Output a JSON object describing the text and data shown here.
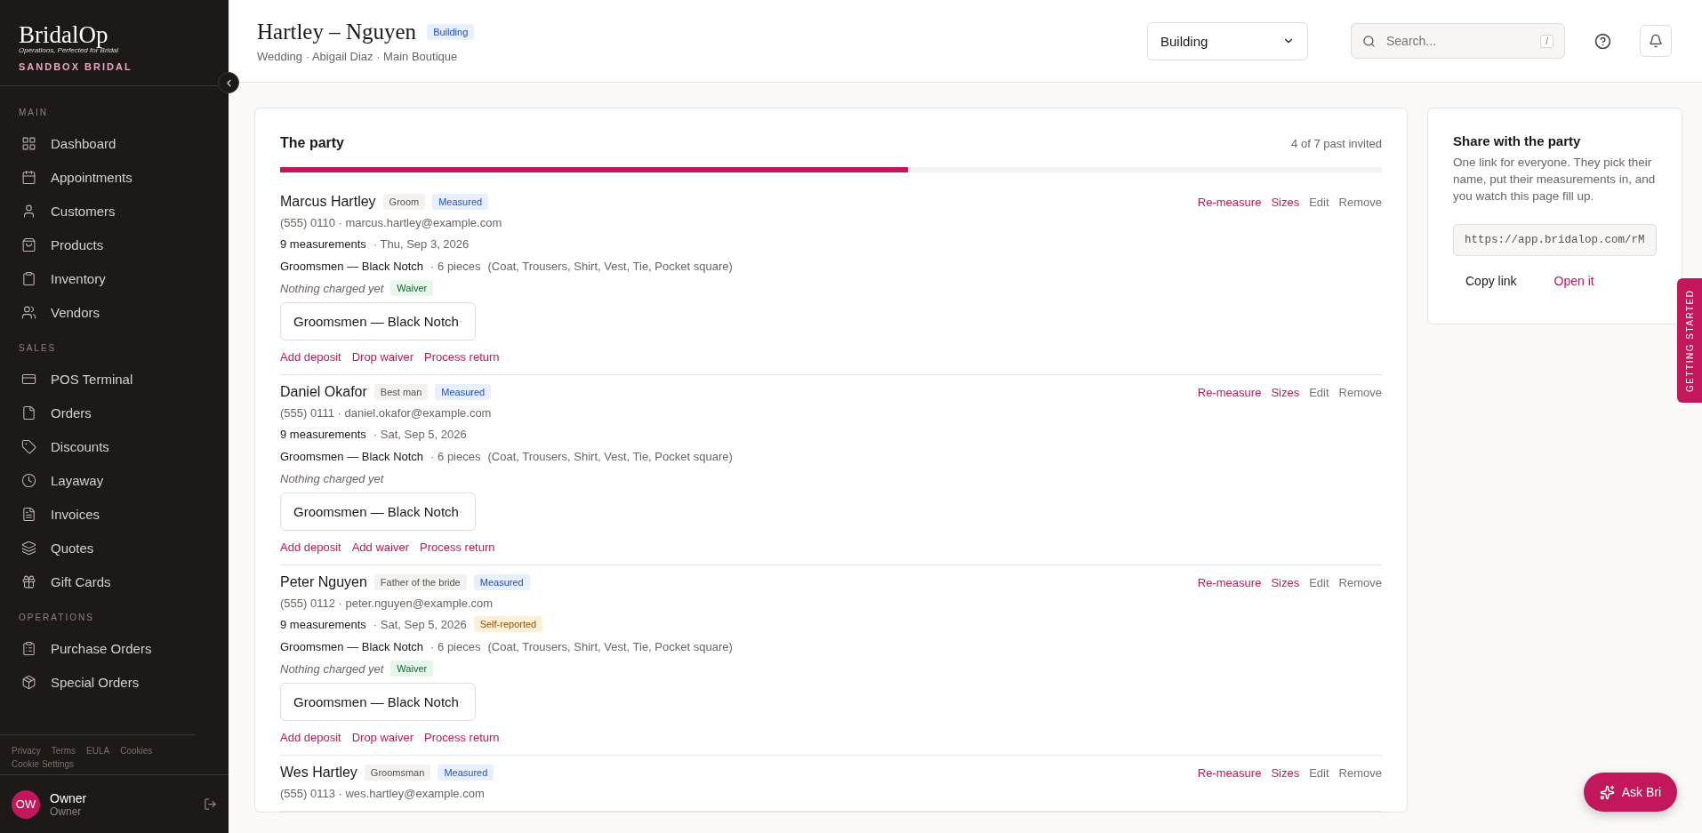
{
  "sidebar": {
    "logo": "BridalOp",
    "tagline": "Operations, Perfected for Bridal",
    "org": "SANDBOX BRIDAL",
    "sections": [
      {
        "heading": "MAIN",
        "items": [
          {
            "label": "Dashboard"
          },
          {
            "label": "Appointments"
          },
          {
            "label": "Customers"
          },
          {
            "label": "Products"
          },
          {
            "label": "Inventory"
          },
          {
            "label": "Vendors"
          }
        ]
      },
      {
        "heading": "SALES",
        "items": [
          {
            "label": "POS Terminal"
          },
          {
            "label": "Orders"
          },
          {
            "label": "Discounts"
          },
          {
            "label": "Layaway"
          },
          {
            "label": "Invoices"
          },
          {
            "label": "Quotes"
          },
          {
            "label": "Gift Cards"
          }
        ]
      },
      {
        "heading": "OPERATIONS",
        "items": [
          {
            "label": "Purchase Orders"
          },
          {
            "label": "Special Orders"
          }
        ]
      }
    ],
    "footer_links": [
      "Privacy",
      "Terms",
      "EULA",
      "Cookies",
      "Cookie Settings"
    ],
    "user": {
      "initials": "OW",
      "name": "Owner",
      "role": "Owner"
    }
  },
  "header": {
    "title": "Hartley – Nguyen",
    "status_badge": "Building",
    "subtitle": "Wedding · Abigail Diaz · Main Boutique",
    "status_select": "Building",
    "search": {
      "placeholder": "Search...",
      "shortcut": "/"
    }
  },
  "party": {
    "title": "The party",
    "progress_text": "4 of 7 past invited",
    "level": 0.57,
    "members": [
      {
        "name": "Marcus Hartley",
        "role": "Groom",
        "status": "Measured",
        "contact": "(555) 0110 · marcus.hartley@example.com",
        "measurements": "9 measurements",
        "date": "· Thu, Sep 3, 2026",
        "outfit": "Groomsmen — Black Notch",
        "pieces": "· 6 pieces",
        "pieces_detail": "(Coat, Trousers, Shirt, Vest, Tie, Pocket square)",
        "charge_note": "Nothing charged yet",
        "waiver": "Waiver",
        "outfit_select": "Groomsmen — Black Notch",
        "actions": [
          {
            "label": "Re-measure",
            "kind": "primary"
          },
          {
            "label": "Sizes",
            "kind": "primary"
          },
          {
            "label": "Edit",
            "kind": "secondary"
          },
          {
            "label": "Remove",
            "kind": "secondary"
          }
        ],
        "links": [
          "Add deposit",
          "Drop waiver",
          "Process return"
        ]
      },
      {
        "name": "Daniel Okafor",
        "role": "Best man",
        "status": "Measured",
        "contact": "(555) 0111 · daniel.okafor@example.com",
        "measurements": "9 measurements",
        "date": "· Sat, Sep 5, 2026",
        "outfit": "Groomsmen — Black Notch",
        "pieces": "· 6 pieces",
        "pieces_detail": "(Coat, Trousers, Shirt, Vest, Tie, Pocket square)",
        "charge_note": "Nothing charged yet",
        "outfit_select": "Groomsmen — Black Notch",
        "actions": [
          {
            "label": "Re-measure",
            "kind": "primary"
          },
          {
            "label": "Sizes",
            "kind": "primary"
          },
          {
            "label": "Edit",
            "kind": "secondary"
          },
          {
            "label": "Remove",
            "kind": "secondary"
          }
        ],
        "links": [
          "Add deposit",
          "Add waiver",
          "Process return"
        ]
      },
      {
        "name": "Peter Nguyen",
        "role": "Father of the bride",
        "status": "Measured",
        "contact": "(555) 0112 · peter.nguyen@example.com",
        "measurements": "9 measurements",
        "date": "· Sat, Sep 5, 2026",
        "source_badge": "Self-reported",
        "outfit": "Groomsmen — Black Notch",
        "pieces": "· 6 pieces",
        "pieces_detail": "(Coat, Trousers, Shirt, Vest, Tie, Pocket square)",
        "charge_note": "Nothing charged yet",
        "waiver": "Waiver",
        "outfit_select": "Groomsmen — Black Notch",
        "actions": [
          {
            "label": "Re-measure",
            "kind": "primary"
          },
          {
            "label": "Sizes",
            "kind": "primary"
          },
          {
            "label": "Edit",
            "kind": "secondary"
          },
          {
            "label": "Remove",
            "kind": "secondary"
          }
        ],
        "links": [
          "Add deposit",
          "Drop waiver",
          "Process return"
        ]
      },
      {
        "name": "Wes Hartley",
        "role": "Groomsman",
        "status": "Measured",
        "contact": "(555) 0113 · wes.hartley@example.com",
        "actions": [
          {
            "label": "Re-measure",
            "kind": "primary"
          },
          {
            "label": "Sizes",
            "kind": "primary"
          },
          {
            "label": "Edit",
            "kind": "secondary"
          },
          {
            "label": "Remove",
            "kind": "secondary"
          }
        ]
      }
    ]
  },
  "share": {
    "title": "Share with the party",
    "text": "One link for everyone. They pick their name, put their measurements in, and you watch this page fill up.",
    "link": "https://app.bridalop.com/rM",
    "copy": "Copy link",
    "open": "Open it"
  },
  "getting_started": "GETTING STARTED",
  "ask": "Ask Bri"
}
